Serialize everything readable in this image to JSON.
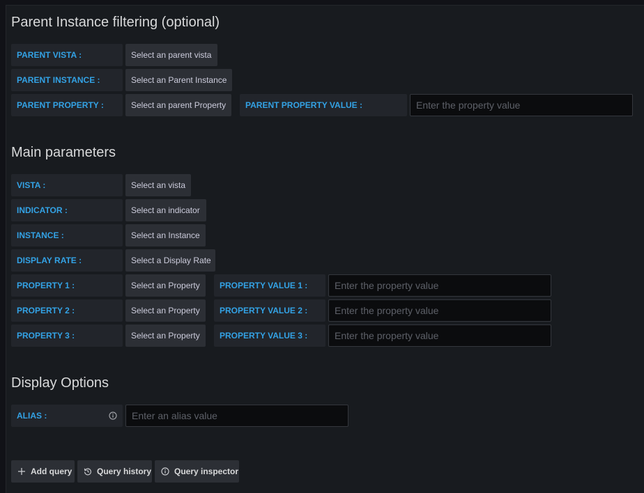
{
  "parent_section": {
    "title": "Parent Instance filtering (optional)",
    "vista_label": "PARENT VISTA :",
    "vista_select": "Select an parent vista",
    "instance_label": "PARENT INSTANCE :",
    "instance_select": "Select an Parent Instance",
    "property_label": "PARENT PROPERTY :",
    "property_select": "Select an parent Property",
    "property_value_label": "PARENT PROPERTY VALUE :",
    "property_value_placeholder": "Enter the property value"
  },
  "main_section": {
    "title": "Main parameters",
    "vista_label": "VISTA :",
    "vista_select": "Select an vista",
    "indicator_label": "INDICATOR :",
    "indicator_select": "Select an indicator",
    "instance_label": "INSTANCE :",
    "instance_select": "Select an Instance",
    "display_rate_label": "DISPLAY RATE :",
    "display_rate_select": "Select a Display Rate",
    "properties": [
      {
        "label": "PROPERTY 1 :",
        "select": "Select an Property",
        "value_label": "PROPERTY VALUE 1 :",
        "placeholder": "Enter the property value"
      },
      {
        "label": "PROPERTY 2 :",
        "select": "Select an Property",
        "value_label": "PROPERTY VALUE 2 :",
        "placeholder": "Enter the property value"
      },
      {
        "label": "PROPERTY 3 :",
        "select": "Select an Property",
        "value_label": "PROPERTY VALUE 3 :",
        "placeholder": "Enter the property value"
      }
    ]
  },
  "display_section": {
    "title": "Display Options",
    "alias_label": "ALIAS :",
    "alias_icon": "info-icon",
    "alias_placeholder": "Enter an alias value"
  },
  "footer": {
    "add_query": {
      "label": "Add query",
      "icon": "plus-icon"
    },
    "query_history": {
      "label": "Query history",
      "icon": "history-icon"
    },
    "query_inspector": {
      "label": "Query inspector",
      "icon": "info-icon"
    }
  },
  "colors": {
    "background": "#181b1f",
    "label_text": "#33a2e5",
    "label_bg": "#22252b",
    "select_bg": "#2c2f35",
    "input_bg": "#0b0c0e"
  }
}
